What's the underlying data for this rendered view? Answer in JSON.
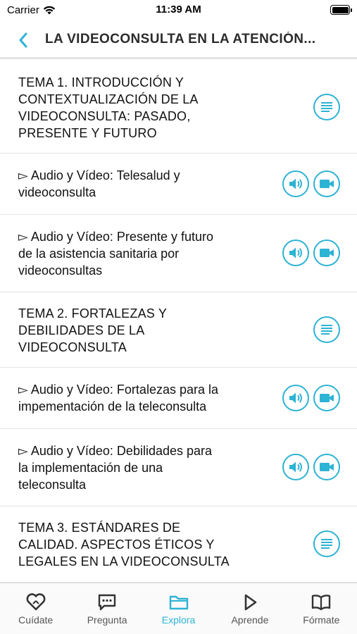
{
  "status_bar": {
    "carrier": "Carrier",
    "time": "11:39 AM"
  },
  "nav": {
    "title": "LA VIDEOCONSULTA EN LA ATENCIÓN..."
  },
  "list": [
    {
      "type": "topic",
      "text": "TEMA 1. INTRODUCCIÓN Y CONTEXTUALIZACIÓN DE LA VIDEOCONSULTA: PASADO, PRESENTE Y FUTURO",
      "lines": [
        "TEMA 1. INTRODUCCIÓN Y",
        "CONTEXTUALIZACIÓN DE LA",
        "VIDEOCONSULTA: PASADO,",
        "PRESENTE Y FUTURO"
      ]
    },
    {
      "type": "media",
      "lines": [
        "▻ Audio y Vídeo: Telesalud y",
        "videoconsulta"
      ]
    },
    {
      "type": "media",
      "lines": [
        "▻ Audio y Vídeo: Presente y futuro",
        "de la asistencia sanitaria por",
        "videoconsultas"
      ]
    },
    {
      "type": "topic",
      "lines": [
        "TEMA 2. FORTALEZAS Y",
        "DEBILIDADES DE LA",
        "VIDEOCONSULTA"
      ]
    },
    {
      "type": "media",
      "lines": [
        "▻ Audio y Vídeo: Fortalezas para la",
        "impementación de la teleconsulta"
      ]
    },
    {
      "type": "media",
      "lines": [
        "▻ Audio y Vídeo: Debilidades para",
        "la implementación de una",
        "teleconsulta"
      ]
    },
    {
      "type": "topic",
      "lines": [
        "TEMA 3. ESTÁNDARES DE",
        "CALIDAD. ASPECTOS ÉTICOS Y",
        "LEGALES EN LA VIDEOCONSULTA"
      ]
    }
  ],
  "tabs": [
    {
      "label": "Cuídate",
      "icon": "heart-outline-icon",
      "active": false
    },
    {
      "label": "Pregunta",
      "icon": "chat-bubble-icon",
      "active": false
    },
    {
      "label": "Explora",
      "icon": "folder-icon",
      "active": true
    },
    {
      "label": "Aprende",
      "icon": "play-outline-icon",
      "active": false
    },
    {
      "label": "Fórmate",
      "icon": "open-book-icon",
      "active": false
    }
  ],
  "colors": {
    "accent": "#2db3d4",
    "text": "#111111",
    "divider": "#e4e4e4"
  }
}
